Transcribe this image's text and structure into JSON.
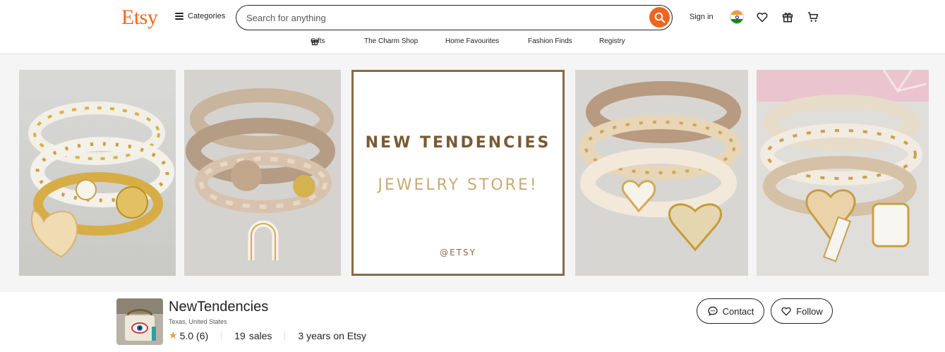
{
  "header": {
    "logo": "Etsy",
    "categories_label": "Categories",
    "search_placeholder": "Search for anything",
    "sign_in": "Sign in"
  },
  "subnav": {
    "items": [
      "Gifts",
      "The Charm Shop",
      "Home Favourites",
      "Fashion Finds",
      "Registry"
    ]
  },
  "banner": {
    "title": "NEW TENDENCIES",
    "subtitle": "JEWELRY STORE!",
    "footer": "@ETSY"
  },
  "shop": {
    "name": "NewTendencies",
    "location": "Texas, United States",
    "rating": "5.0",
    "review_count": "(6)",
    "sales_count": "19",
    "sales_label": "sales",
    "years": "3 years",
    "years_suffix": "on Etsy",
    "contact_label": "Contact",
    "follow_label": "Follow"
  },
  "colors": {
    "brand": "#f1641e",
    "banner_brown": "#7a5a35",
    "banner_gold": "#c8ab72",
    "star": "#e6a23c"
  }
}
